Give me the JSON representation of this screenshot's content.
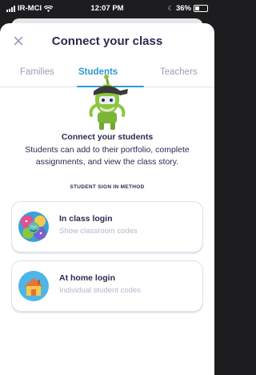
{
  "status_bar": {
    "carrier": "IR-MCI",
    "time": "12:07 PM",
    "battery": "36%",
    "battery_level": 0.36
  },
  "header": {
    "title": "Connect your class"
  },
  "tabs": [
    {
      "label": "Families",
      "active": false
    },
    {
      "label": "Students",
      "active": true
    },
    {
      "label": "Teachers",
      "active": false
    }
  ],
  "intro": {
    "title": "Connect your students",
    "body": "Students can add to their portfolio, complete assignments, and view the class story."
  },
  "sign_in": {
    "section_label": "STUDENT SIGN IN METHOD",
    "options": [
      {
        "title": "In class login",
        "subtitle": "Show classroom codes",
        "icon": "classroom-monsters-icon"
      },
      {
        "title": "At home login",
        "subtitle": "Individual student codes",
        "icon": "house-icon"
      }
    ]
  },
  "colors": {
    "accent": "#2c9ad0",
    "heading": "#2c2a50",
    "muted": "#9aa0b6",
    "monster_green": "#8cc63f"
  }
}
